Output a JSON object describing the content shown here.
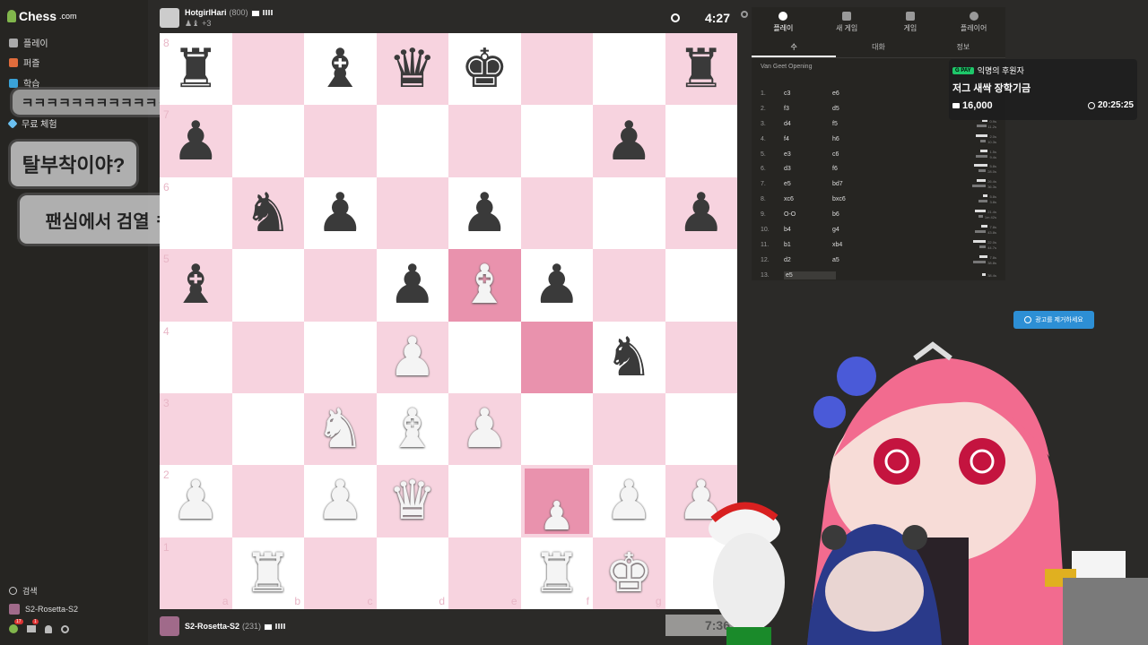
{
  "sidebar": {
    "logo": "Chess",
    "logo_suffix": ".com",
    "items": [
      {
        "label": "플레이",
        "icon": "pawn-icon"
      },
      {
        "label": "퍼즐",
        "icon": "puzzle-icon"
      },
      {
        "label": "학습",
        "icon": "learn-icon"
      },
      {
        "label": "무료 체험",
        "icon": "diamond-icon"
      }
    ],
    "bottom": {
      "search": "검색",
      "user": "S2-Rosetta-S2",
      "badge1": "17",
      "badge2": "1"
    }
  },
  "chat_bubbles": {
    "laugh": "ㅋㅋㅋㅋㅋㅋㅋㅋㅋㅋㅋㅋ",
    "q": "탈부착이야?",
    "c": "팬심에서 검열 ㅋㅋㅋ"
  },
  "opponent": {
    "name": "HotgirlHari",
    "rating": "(800)",
    "captured": "+3",
    "clock": "4:27"
  },
  "player": {
    "name": "S2-Rosetta-S2",
    "rating": "(231)",
    "clock": "7:36"
  },
  "board": {
    "ranks": [
      "8",
      "7",
      "6",
      "5",
      "4",
      "3",
      "2",
      "1"
    ],
    "files": [
      "a",
      "b",
      "c",
      "d",
      "e",
      "f",
      "g",
      "h"
    ],
    "rows": [
      [
        "r",
        "",
        "b",
        "q",
        "k",
        "",
        "",
        "r"
      ],
      [
        "p",
        "",
        "",
        "",
        "",
        "",
        "p",
        ""
      ],
      [
        "",
        "n",
        "p",
        "",
        "p",
        "",
        "",
        "p"
      ],
      [
        "b",
        "",
        "",
        "p",
        "B",
        "p",
        "",
        ""
      ],
      [
        "",
        "",
        "",
        "P",
        "",
        "",
        "n",
        ""
      ],
      [
        "",
        "",
        "N",
        "B",
        "P",
        "",
        "",
        ""
      ],
      [
        "P",
        "",
        "P",
        "Q",
        "",
        "",
        "P",
        "P"
      ],
      [
        "",
        "R",
        "",
        "",
        "",
        "R",
        "K",
        ""
      ]
    ],
    "highlights": [
      [
        3,
        4
      ],
      [
        4,
        5
      ]
    ],
    "drag_square": [
      6,
      5
    ],
    "dragging_piece": "P"
  },
  "panel": {
    "tabs": [
      {
        "label": "플레이",
        "icon": "stopwatch-icon"
      },
      {
        "label": "새 게임",
        "icon": "plus-icon"
      },
      {
        "label": "게임",
        "icon": "board-icon"
      },
      {
        "label": "플레이어",
        "icon": "players-icon"
      }
    ],
    "subtabs": [
      "수",
      "대화",
      "정보"
    ],
    "opening": "Van Geet Opening",
    "moves": [
      {
        "n": "1.",
        "w": "c3",
        "b": "e6",
        "t1": "",
        "t2": ""
      },
      {
        "n": "2.",
        "w": "f3",
        "b": "d5",
        "t1": "",
        "t2": ""
      },
      {
        "n": "3.",
        "w": "d4",
        "b": "f5",
        "t1": "0.9s",
        "t2": "11.2s"
      },
      {
        "n": "4.",
        "w": "f4",
        "b": "h6",
        "t1": "2.0s",
        "t2": "10.3s"
      },
      {
        "n": "5.",
        "w": "e3",
        "b": "c6",
        "t1": "1.5s",
        "t2": "9.4s"
      },
      {
        "n": "6.",
        "w": "d3",
        "b": "f6",
        "t1": "5.8s",
        "t2": "28.0s"
      },
      {
        "n": "7.",
        "w": "e5",
        "b": "bd7",
        "t1": "26.4s",
        "t2": "36.3s"
      },
      {
        "n": "8.",
        "w": "xc6",
        "b": "bxc6",
        "t1": "5.8s",
        "t2": "3.8s"
      },
      {
        "n": "9.",
        "w": "O-O",
        "b": "b6",
        "t1": "21.4s",
        "t2": "1m 42s"
      },
      {
        "n": "10.",
        "w": "b4",
        "b": "g4",
        "t1": "7.8s",
        "t2": "43.8s"
      },
      {
        "n": "11.",
        "w": "b1",
        "b": "xb4",
        "t1": "22.0s",
        "t2": "44.7s"
      },
      {
        "n": "12.",
        "w": "d2",
        "b": "a5",
        "t1": "7.8s",
        "t2": "38.8s"
      },
      {
        "n": "13.",
        "w": "e5",
        "b": "",
        "t1": "38.4s",
        "t2": ""
      }
    ]
  },
  "donation": {
    "badge": "G PAY",
    "title": "익명의 후원자",
    "subtitle": "저그 새싹 장학기금",
    "amount": "16,000",
    "time": "20:25:25"
  },
  "ad_button": "광고를 제거하세요"
}
